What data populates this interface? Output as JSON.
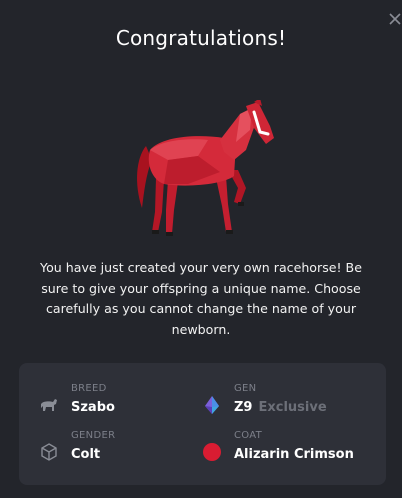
{
  "dialog": {
    "title": "Congratulations!",
    "message": "You have just created your very own racehorse! Be sure to give your offspring a unique name. Choose carefully as you cannot change the name of your newborn."
  },
  "close": {
    "icon": "close-icon"
  },
  "horse": {
    "icon": "horse-illustration",
    "color": "#d42a3a"
  },
  "attributes": {
    "breed": {
      "label": "BREED",
      "value": "Szabo",
      "icon": "horse-icon"
    },
    "gen": {
      "label": "GEN",
      "value": "Z9",
      "tag": "Exclusive",
      "icon": "diamond-gem-icon"
    },
    "gender": {
      "label": "GENDER",
      "value": "Colt",
      "icon": "cube-icon"
    },
    "coat": {
      "label": "COAT",
      "value": "Alizarin Crimson",
      "icon": "color-dot-icon",
      "color": "#d91c32"
    }
  }
}
